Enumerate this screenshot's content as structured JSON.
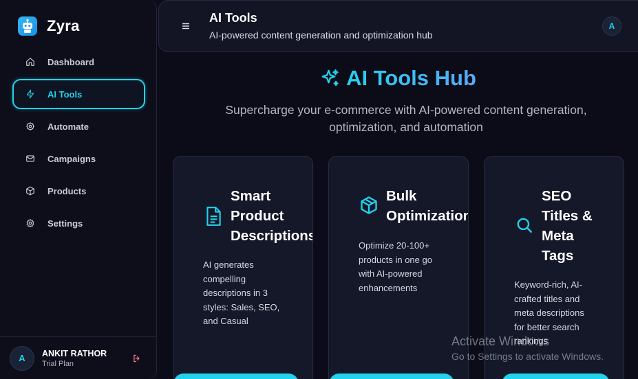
{
  "brand": {
    "name": "Zyra",
    "logo_icon": "robot-icon"
  },
  "sidebar": {
    "items": [
      {
        "label": "Dashboard",
        "icon": "home-icon",
        "active": false
      },
      {
        "label": "AI Tools",
        "icon": "lightning-icon",
        "active": true
      },
      {
        "label": "Automate",
        "icon": "gear-icon",
        "active": false
      },
      {
        "label": "Campaigns",
        "icon": "mail-icon",
        "active": false
      },
      {
        "label": "Products",
        "icon": "box-icon",
        "active": false
      },
      {
        "label": "Settings",
        "icon": "settings-icon",
        "active": false
      }
    ]
  },
  "user": {
    "initial": "A",
    "name": "ANKIT RATHOR",
    "plan": "Trial Plan"
  },
  "header": {
    "title": "AI Tools",
    "subtitle": "AI-powered content generation and optimization hub",
    "avatar_initial": "A"
  },
  "hero": {
    "title": "AI Tools Hub",
    "subtitle_line1": "Supercharge your e-commerce with AI-powered content generation,",
    "subtitle_line2": "optimization, and automation"
  },
  "cards": [
    {
      "title": "Smart\nProduct\nDescriptions",
      "icon": "document-icon",
      "desc": "AI generates compelling descriptions in 3 styles: Sales, SEO, and Casual"
    },
    {
      "title": "Bulk\nOptimization",
      "icon": "cube-icon",
      "desc": "Optimize 20-100+ products in one go with AI-powered enhancements"
    },
    {
      "title": "SEO\nTitles &\nMeta\nTags",
      "icon": "search-icon",
      "desc": "Keyword-rich, AI-crafted titles and meta descriptions for better search rankings"
    }
  ],
  "watermark": {
    "line1": "Activate Windows",
    "line2": "Go to Settings to activate Windows."
  },
  "colors": {
    "accent": "#22d3ee",
    "background": "#0b0c18",
    "card": "#151829"
  }
}
